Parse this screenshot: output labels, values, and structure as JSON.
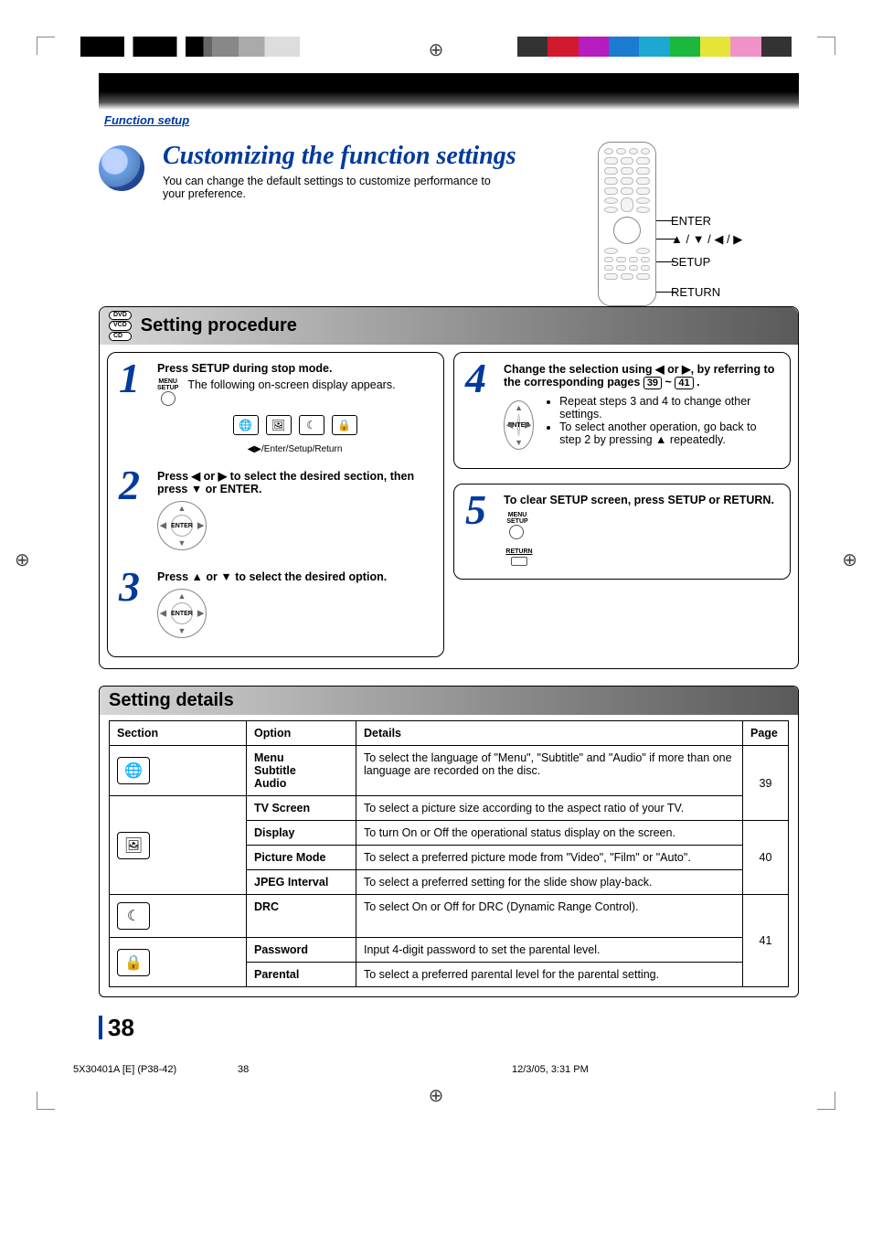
{
  "header": {
    "breadcrumb": "Function setup"
  },
  "title": {
    "main": "Customizing the function settings",
    "sub": "You can change the default settings to customize performance to your preference."
  },
  "remote_labels": {
    "enter": "ENTER",
    "arrows": "▲ / ▼ / ◀ / ▶",
    "setup": "SETUP",
    "return": "RETURN"
  },
  "disc_types": [
    "DVD",
    "VCD",
    "CD"
  ],
  "sections": {
    "procedure_title": "Setting procedure",
    "details_title": "Setting details"
  },
  "steps": {
    "s1": {
      "num": "1",
      "lead": "Press SETUP during stop mode.",
      "body": "The following on-screen display appears.",
      "icon_label": "MENU\nSETUP",
      "osd_caption": "◀▶/Enter/Setup/Return"
    },
    "s2": {
      "num": "2",
      "lead": "Press ◀ or ▶ to select the desired section, then press ▼ or ENTER."
    },
    "s3": {
      "num": "3",
      "lead": "Press ▲ or ▼ to select the desired option."
    },
    "s4": {
      "num": "4",
      "lead_prefix": "Change the selection using ◀ or ▶, by referring to the corresponding pages ",
      "ref1": "39",
      "sep": " ~ ",
      "ref2": "41",
      "lead_suffix": ".",
      "bullet1": "Repeat steps 3 and 4 to change other settings.",
      "bullet2": "To select another operation, go back to step 2 by pressing ▲ repeatedly."
    },
    "s5": {
      "num": "5",
      "lead": "To clear SETUP screen, press SETUP or RETURN.",
      "icon1_label": "MENU\nSETUP",
      "icon2_label": "RETURN"
    }
  },
  "table": {
    "headers": {
      "section": "Section",
      "option": "Option",
      "details": "Details",
      "page": "Page"
    },
    "rows": [
      {
        "section_icon": "globe-icon",
        "option": "Menu\nSubtitle\nAudio",
        "details": "To select the language of \"Menu\", \"Subtitle\" and \"Audio\" if more than one language are recorded on the disc.",
        "page": "39",
        "span": 1
      },
      {
        "section_icon": "picture-icon",
        "option": "TV Screen",
        "details": "To select a picture size according to the aspect ratio of your TV.",
        "page": "39"
      },
      {
        "option": "Display",
        "details": "To turn On or Off the operational status display on the screen."
      },
      {
        "option": "Picture Mode",
        "details": "To select a preferred picture mode from \"Video\", \"Film\" or \"Auto\".",
        "page": "40"
      },
      {
        "option": "JPEG Interval",
        "details": "To select a preferred setting for the slide show play-back.",
        "page": "40"
      },
      {
        "section_icon": "audio-icon",
        "option": "DRC",
        "details": "To select On or Off for DRC (Dynamic Range Control)."
      },
      {
        "section_icon": "lock-icon",
        "option": "Password",
        "details": "Input 4-digit password to set the parental level.",
        "page": "41"
      },
      {
        "option": "Parental",
        "details": "To select a preferred parental level for the parental setting.",
        "page": "41"
      }
    ]
  },
  "page_number": "38",
  "footer": {
    "doc_id": "5X30401A [E] (P38-42)",
    "page": "38",
    "timestamp": "12/3/05, 3:31 PM"
  }
}
